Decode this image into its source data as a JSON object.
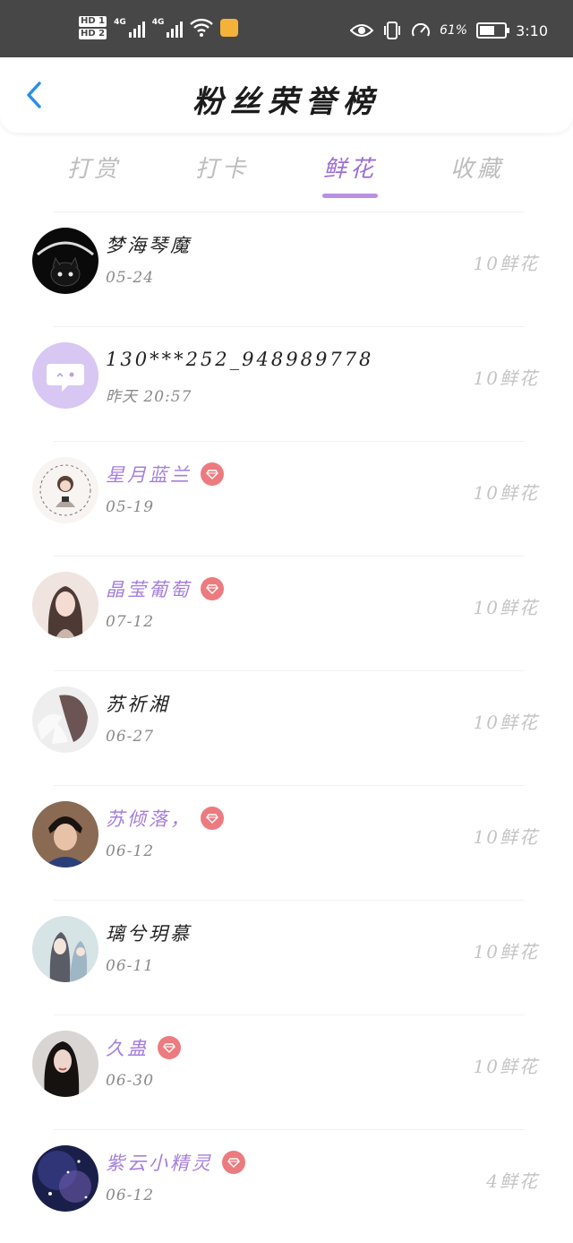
{
  "status_bar": {
    "sim1": "HD 1",
    "sim2": "HD 2",
    "network1": "4G",
    "network2": "4G",
    "battery_percent": "61%",
    "battery_level": 0.61,
    "time": "3:10",
    "icons": [
      "eye-icon",
      "vibrate-icon",
      "speed-icon",
      "wifi-icon",
      "battery-icon"
    ]
  },
  "header": {
    "back_icon": "chevron-left-icon",
    "title": "粉丝荣誉榜",
    "accent_color": "#9c6fd6"
  },
  "tabs": [
    {
      "label": "打赏",
      "active": false
    },
    {
      "label": "打卡",
      "active": false
    },
    {
      "label": "鲜花",
      "active": true
    },
    {
      "label": "收藏",
      "active": false
    }
  ],
  "fans": [
    {
      "name": "梦海琴魔",
      "date": "05-24",
      "amount": "10鲜花",
      "vip": false
    },
    {
      "name": "130***252_948989778",
      "date": "昨天  20:57",
      "amount": "10鲜花",
      "vip": false
    },
    {
      "name": "星月蓝兰",
      "date": "05-19",
      "amount": "10鲜花",
      "vip": true
    },
    {
      "name": "晶莹葡萄",
      "date": "07-12",
      "amount": "10鲜花",
      "vip": true
    },
    {
      "name": "苏祈湘",
      "date": "06-27",
      "amount": "10鲜花",
      "vip": false
    },
    {
      "name": "苏倾落，",
      "date": "06-12",
      "amount": "10鲜花",
      "vip": true
    },
    {
      "name": "璃兮玥慕",
      "date": "06-11",
      "amount": "10鲜花",
      "vip": false
    },
    {
      "name": "久蛊",
      "date": "06-30",
      "amount": "10鲜花",
      "vip": true
    },
    {
      "name": "紫云小精灵",
      "date": "06-12",
      "amount": "4鲜花",
      "vip": true
    }
  ]
}
